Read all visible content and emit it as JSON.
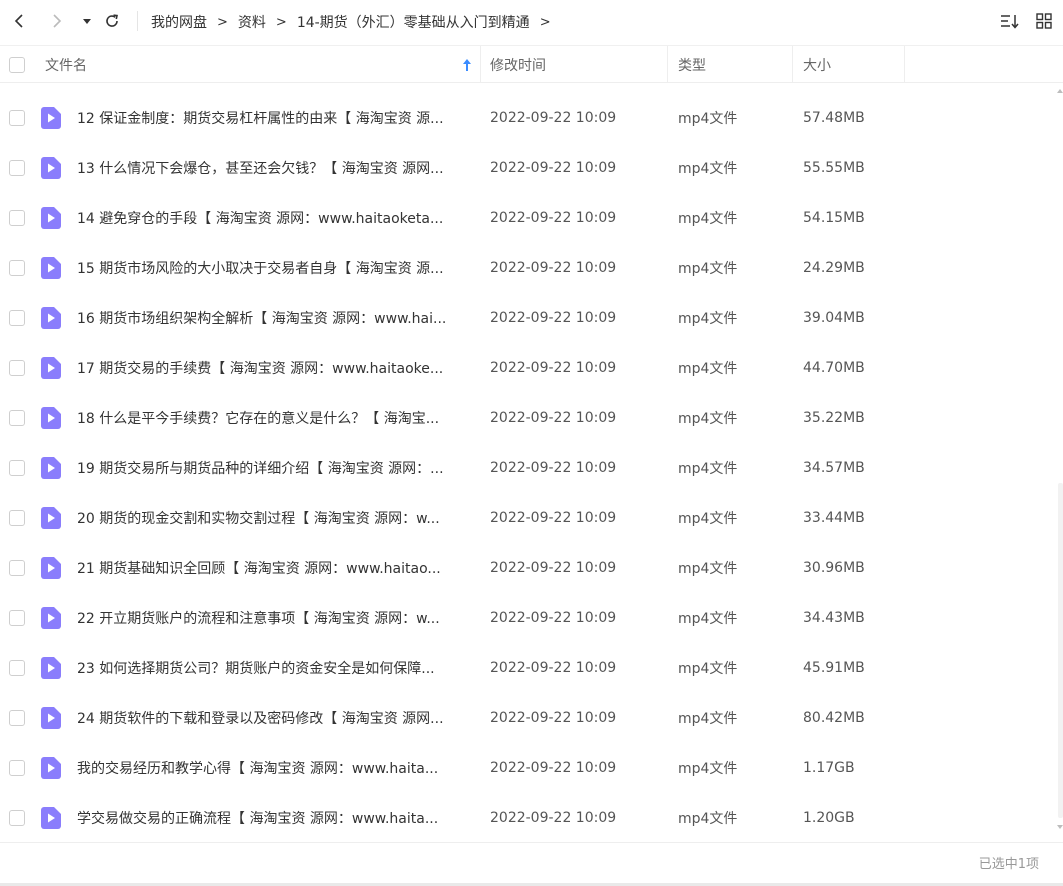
{
  "nav": {
    "breadcrumb": [
      "我的网盘",
      "资料",
      "14-期货（外汇）零基础从入门到精通"
    ],
    "separator": ">"
  },
  "columns": {
    "name": "文件名",
    "modified": "修改时间",
    "type": "类型",
    "size": "大小"
  },
  "files": [
    {
      "name": "12 保证金制度：期货交易杠杆属性的由来【 海淘宝资 源...",
      "modified": "2022-09-22 10:09",
      "type": "mp4文件",
      "size": "57.48MB"
    },
    {
      "name": "13 什么情况下会爆仓，甚至还会欠钱？【 海淘宝资 源网...",
      "modified": "2022-09-22 10:09",
      "type": "mp4文件",
      "size": "55.55MB"
    },
    {
      "name": "14 避免穿仓的手段【 海淘宝资 源网：www.haitaoketa...",
      "modified": "2022-09-22 10:09",
      "type": "mp4文件",
      "size": "54.15MB"
    },
    {
      "name": "15 期货市场风险的大小取决于交易者自身【 海淘宝资 源...",
      "modified": "2022-09-22 10:09",
      "type": "mp4文件",
      "size": "24.29MB"
    },
    {
      "name": "16 期货市场组织架构全解析【 海淘宝资 源网：www.hai...",
      "modified": "2022-09-22 10:09",
      "type": "mp4文件",
      "size": "39.04MB"
    },
    {
      "name": "17 期货交易的手续费【 海淘宝资 源网：www.haitaoke...",
      "modified": "2022-09-22 10:09",
      "type": "mp4文件",
      "size": "44.70MB"
    },
    {
      "name": "18 什么是平今手续费？它存在的意义是什么？【 海淘宝...",
      "modified": "2022-09-22 10:09",
      "type": "mp4文件",
      "size": "35.22MB"
    },
    {
      "name": "19 期货交易所与期货品种的详细介绍【 海淘宝资 源网：...",
      "modified": "2022-09-22 10:09",
      "type": "mp4文件",
      "size": "34.57MB"
    },
    {
      "name": "20 期货的现金交割和实物交割过程【 海淘宝资 源网：w...",
      "modified": "2022-09-22 10:09",
      "type": "mp4文件",
      "size": "33.44MB"
    },
    {
      "name": "21 期货基础知识全回顾【 海淘宝资 源网：www.haitao...",
      "modified": "2022-09-22 10:09",
      "type": "mp4文件",
      "size": "30.96MB"
    },
    {
      "name": "22 开立期货账户的流程和注意事项【 海淘宝资 源网：w...",
      "modified": "2022-09-22 10:09",
      "type": "mp4文件",
      "size": "34.43MB"
    },
    {
      "name": "23 如何选择期货公司？期货账户的资金安全是如何保障...",
      "modified": "2022-09-22 10:09",
      "type": "mp4文件",
      "size": "45.91MB"
    },
    {
      "name": "24 期货软件的下载和登录以及密码修改【 海淘宝资 源网...",
      "modified": "2022-09-22 10:09",
      "type": "mp4文件",
      "size": "80.42MB"
    },
    {
      "name": "我的交易经历和教学心得【 海淘宝资 源网：www.haita...",
      "modified": "2022-09-22 10:09",
      "type": "mp4文件",
      "size": "1.17GB"
    },
    {
      "name": "学交易做交易的正确流程【 海淘宝资 源网：www.haita...",
      "modified": "2022-09-22 10:09",
      "type": "mp4文件",
      "size": "1.20GB"
    }
  ],
  "status": "已选中1项",
  "icons": {
    "back": "chevron-left-icon",
    "forward": "chevron-right-icon",
    "dropdown": "caret-down-icon",
    "refresh": "refresh-icon",
    "sort": "sort-list-icon",
    "grid": "grid-view-icon",
    "sort_asc": "arrow-up-icon",
    "video_file": "video-file-icon"
  },
  "colors": {
    "accent": "#3b8cff",
    "file_icon": "#8a7dfc",
    "border": "#eeeeee",
    "muted_text": "#999999"
  }
}
